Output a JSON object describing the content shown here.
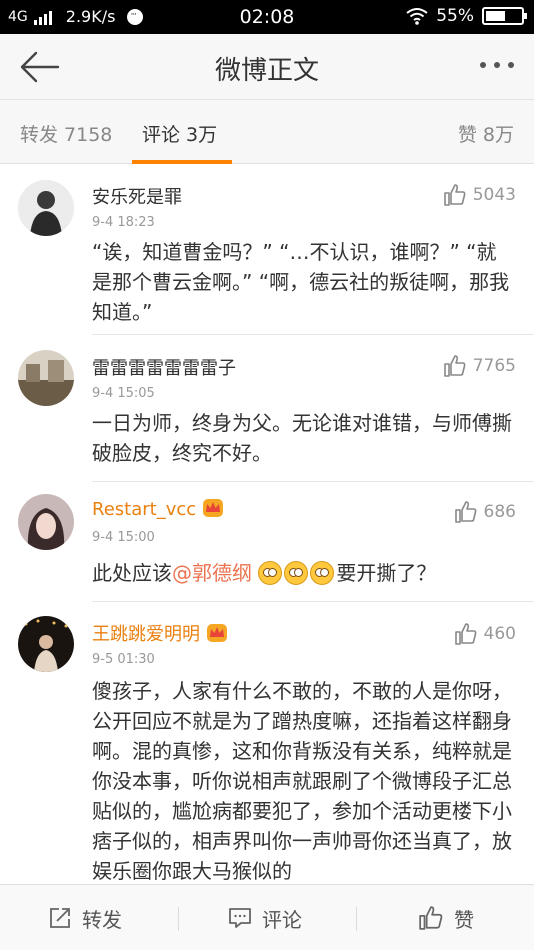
{
  "status_bar": {
    "network": "4G",
    "speed": "2.9K/s",
    "time": "02:08",
    "battery": "55%",
    "battery_level": 0.55
  },
  "nav": {
    "title": "微博正文"
  },
  "tabs": [
    {
      "label": "转发 7158"
    },
    {
      "label": "评论 3万"
    },
    {
      "label": "赞 8万"
    }
  ],
  "comments": [
    {
      "name": "安乐死是罪",
      "time": "9-4 18:23",
      "likes": "5043",
      "text": "“诶，知道曹金吗？” “…不认识，谁啊？” “就是那个曹云金啊。” “啊，德云社的叛徒啊，那我知道。”"
    },
    {
      "name": "雷雷雷雷雷雷雷子",
      "time": "9-4 15:05",
      "likes": "7765",
      "text": "一日为师，终身为父。无论谁对谁错，与师傅撕破脸皮，终究不好。"
    },
    {
      "name": "Restart_vcc",
      "time": "9-4 15:00",
      "likes": "686",
      "text_before": "此处应该",
      "mention": "@郭德纲",
      "text_after": "要开撕了？"
    },
    {
      "name": "王跳跳爱明明",
      "time": "9-5 01:30",
      "likes": "460",
      "text": "傻孩子，人家有什么不敢的，不敢的人是你呀，公开回应不就是为了蹭热度嘛，还指着这样翻身啊。混的真惨，这和你背叛没有关系，纯粹就是你没本事，听你说相声就跟刷了个微博段子汇总贴似的，尴尬病都要犯了，参加个活动更楼下小痞子似的，相声界叫你一声帅哥你还当真了，放娱乐圈你跟大马猴似的"
    }
  ],
  "bottom_bar": {
    "repost": "转发",
    "comment": "评论",
    "like": "赞"
  },
  "colors": {
    "accent": "#ff8200",
    "vip_name": "#ea8010",
    "mention": "#eb7350"
  }
}
